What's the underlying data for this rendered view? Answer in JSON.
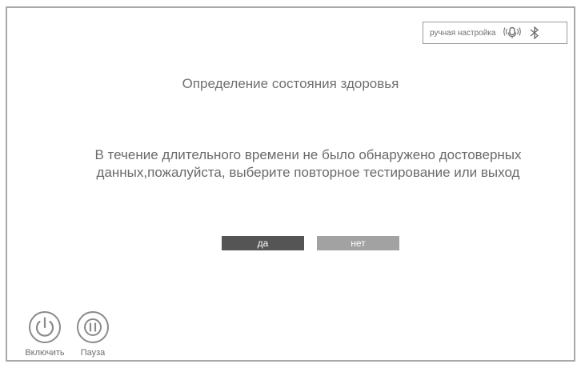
{
  "status_bar": {
    "mode_label": "ручная настройка",
    "icons": [
      "microphone-icon",
      "bluetooth-icon"
    ]
  },
  "screen": {
    "title": "Определение состояния здоровья",
    "message_line1": "В течение длительного времени не было обнаружено достоверных",
    "message_line2": "данных,пожалуйста, выберите повторное тестирование или выход"
  },
  "dialog_buttons": {
    "yes_label": "да",
    "no_label": "нет",
    "yes_color": "#555555",
    "no_color": "#a2a2a2"
  },
  "controls": {
    "power_label": "Включить",
    "pause_label": "Пауза",
    "icons": [
      "power-icon",
      "pause-icon"
    ]
  }
}
